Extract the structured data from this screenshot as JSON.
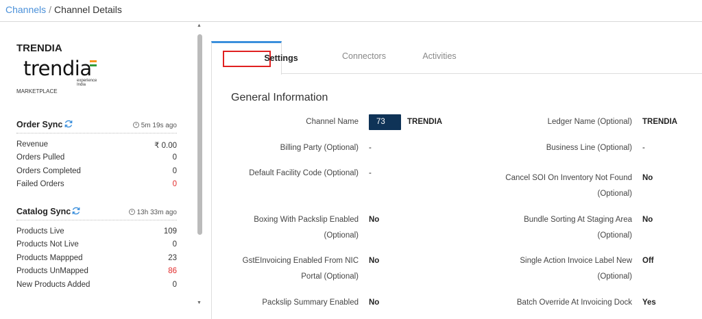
{
  "breadcrumb": {
    "link": "Channels",
    "separator": "/",
    "current": "Channel Details"
  },
  "channel": {
    "name": "TRENDIA",
    "logo_text": "trendia",
    "logo_tagline": "experience India",
    "type": "MARKETPLACE"
  },
  "order_sync": {
    "title": "Order Sync",
    "ago": "5m 19s ago",
    "rows": [
      {
        "label": "Revenue",
        "value": "₹ 0.00"
      },
      {
        "label": "Orders Pulled",
        "value": "0"
      },
      {
        "label": "Orders Completed",
        "value": "0"
      },
      {
        "label": "Failed Orders",
        "value": "0"
      }
    ]
  },
  "catalog_sync": {
    "title": "Catalog Sync",
    "ago": "13h 33m ago",
    "rows": [
      {
        "label": "Products Live",
        "value": "109"
      },
      {
        "label": "Products Not Live",
        "value": "0"
      },
      {
        "label": "Products Mappped",
        "value": "23"
      },
      {
        "label": "Products UnMapped",
        "value": "86"
      },
      {
        "label": "New Products Added",
        "value": "0"
      }
    ]
  },
  "tabs": [
    "Settings",
    "Connectors",
    "Activities"
  ],
  "general": {
    "title": "General Information",
    "channel_name_label": "Channel Name",
    "channel_code": "73",
    "channel_name_value": "TRENDIA",
    "ledger_label": "Ledger Name (Optional)",
    "ledger_value": "TRENDIA",
    "billing_label": "Billing Party (Optional)",
    "billing_value": "-",
    "business_label": "Business Line (Optional)",
    "business_value": "-",
    "facility_label": "Default Facility Code (Optional)",
    "facility_value": "-",
    "cancel_label_1": "Cancel SOI On Inventory Not Found",
    "cancel_label_2": "(Optional)",
    "cancel_value": "No",
    "boxing_label_1": "Boxing With Packslip Enabled",
    "boxing_label_2": "(Optional)",
    "boxing_value": "No",
    "bundle_label_1": "Bundle Sorting At Staging Area",
    "bundle_label_2": "(Optional)",
    "bundle_value": "No",
    "gst_label_1": "GstEInvoicing Enabled From NIC",
    "gst_label_2": "Portal (Optional)",
    "gst_value": "No",
    "single_label_1": "Single Action Invoice Label New",
    "single_label_2": "(Optional)",
    "single_value": "Off",
    "packslip_label": "Packslip Summary Enabled",
    "packslip_value": "No",
    "batch_label": "Batch Override At Invoicing Dock",
    "batch_value": "Yes"
  },
  "colors": {
    "accent": "#3b8fdc",
    "danger": "#e22b2b",
    "chip": "#0f3357",
    "highlight_box": "#e02020"
  }
}
